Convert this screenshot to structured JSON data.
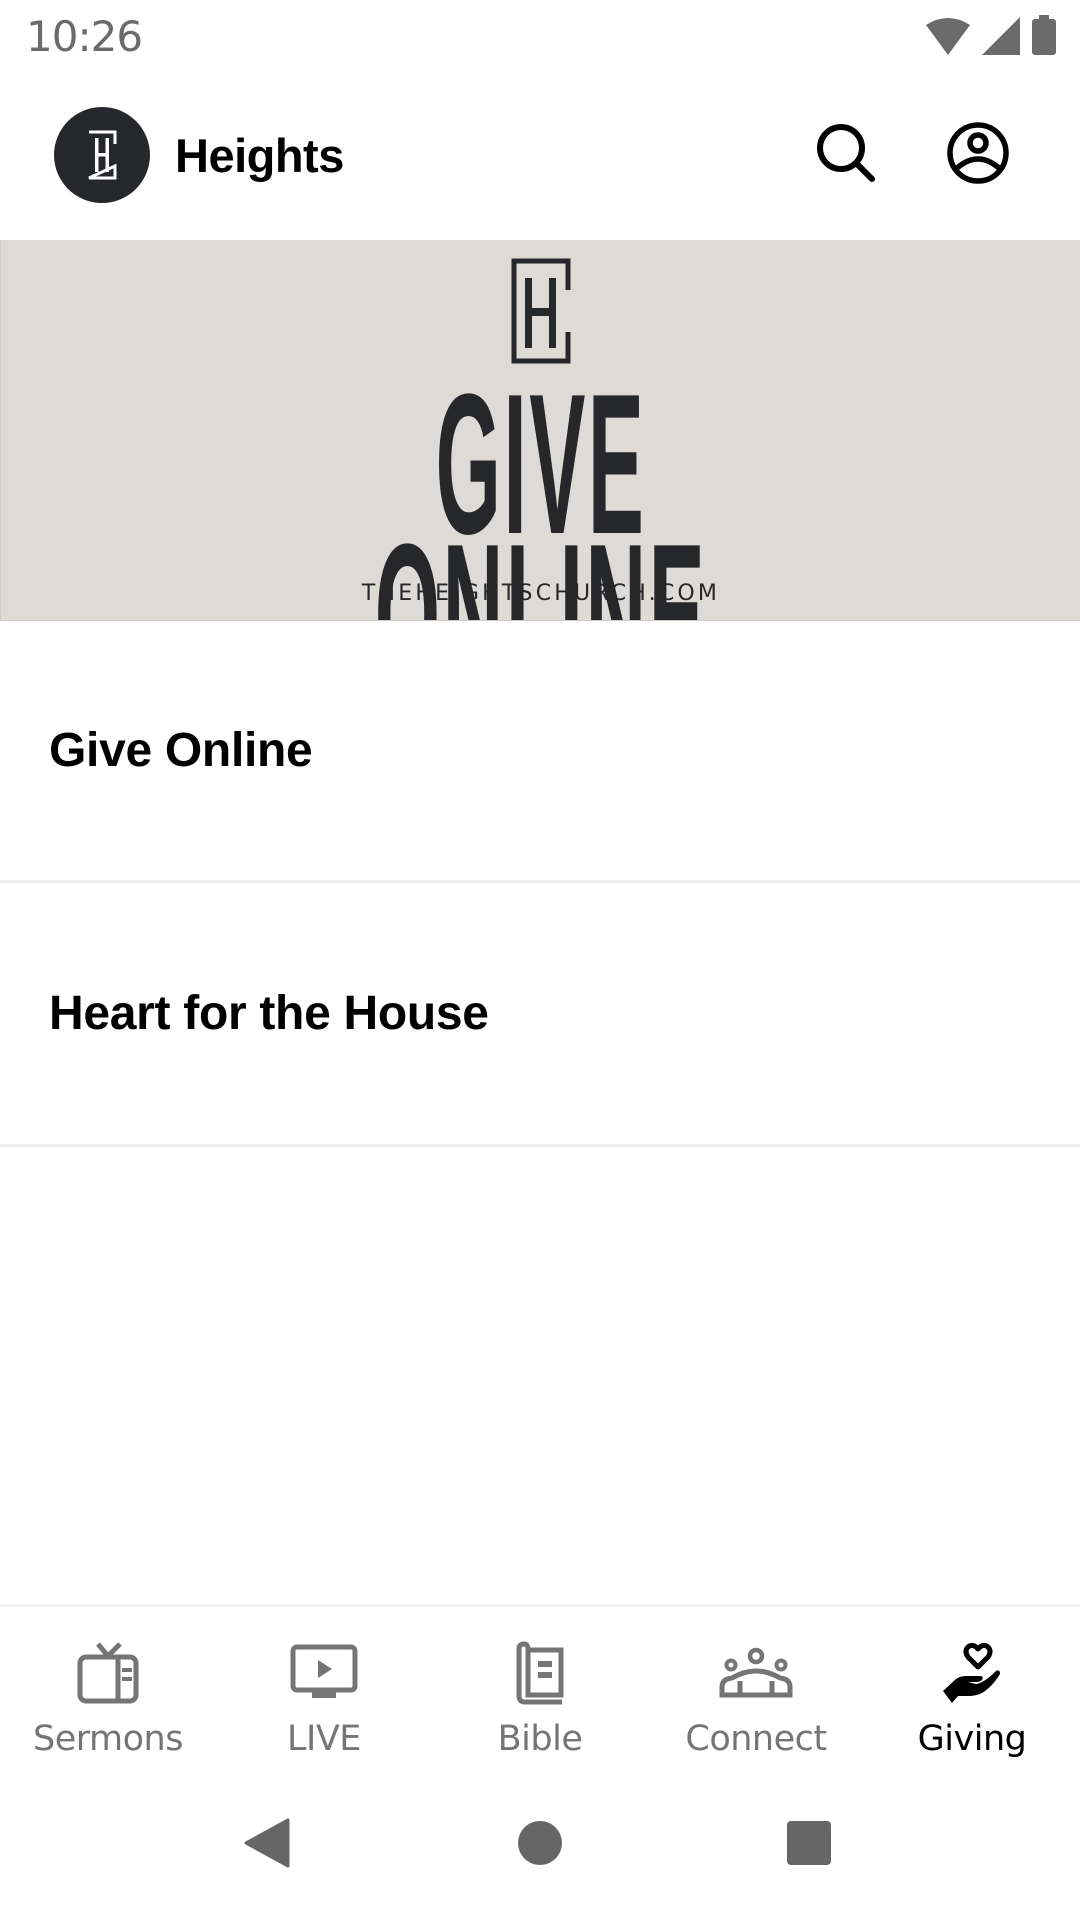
{
  "status_bar": {
    "time": "10:26",
    "icons": [
      "wifi-icon",
      "cell-signal-icon",
      "battery-icon"
    ]
  },
  "app_bar": {
    "logo_icon": "heights-logo-icon",
    "title": "Heights",
    "actions": [
      {
        "name": "search",
        "icon": "search-icon"
      },
      {
        "name": "account",
        "icon": "account-circle-icon"
      }
    ]
  },
  "banner": {
    "logo_icon": "heights-logo-icon",
    "headline": "GIVE ONLINE",
    "url": "THEHEIGHTSCHURCH.COM",
    "background_color": "#dedad5",
    "text_color": "#26272a"
  },
  "list": {
    "items": [
      {
        "label": "Give Online"
      },
      {
        "label": "Heart for the House"
      }
    ]
  },
  "bottom_nav": {
    "active_index": 4,
    "active_color": "#000000",
    "inactive_color": "#757575",
    "tabs": [
      {
        "label": "Sermons",
        "icon": "tv-icon"
      },
      {
        "label": "LIVE",
        "icon": "live-play-icon"
      },
      {
        "label": "Bible",
        "icon": "book-icon"
      },
      {
        "label": "Connect",
        "icon": "groups-icon"
      },
      {
        "label": "Giving",
        "icon": "giving-hand-heart-icon"
      }
    ]
  },
  "system_nav": {
    "buttons": [
      "back",
      "home",
      "recents"
    ]
  }
}
